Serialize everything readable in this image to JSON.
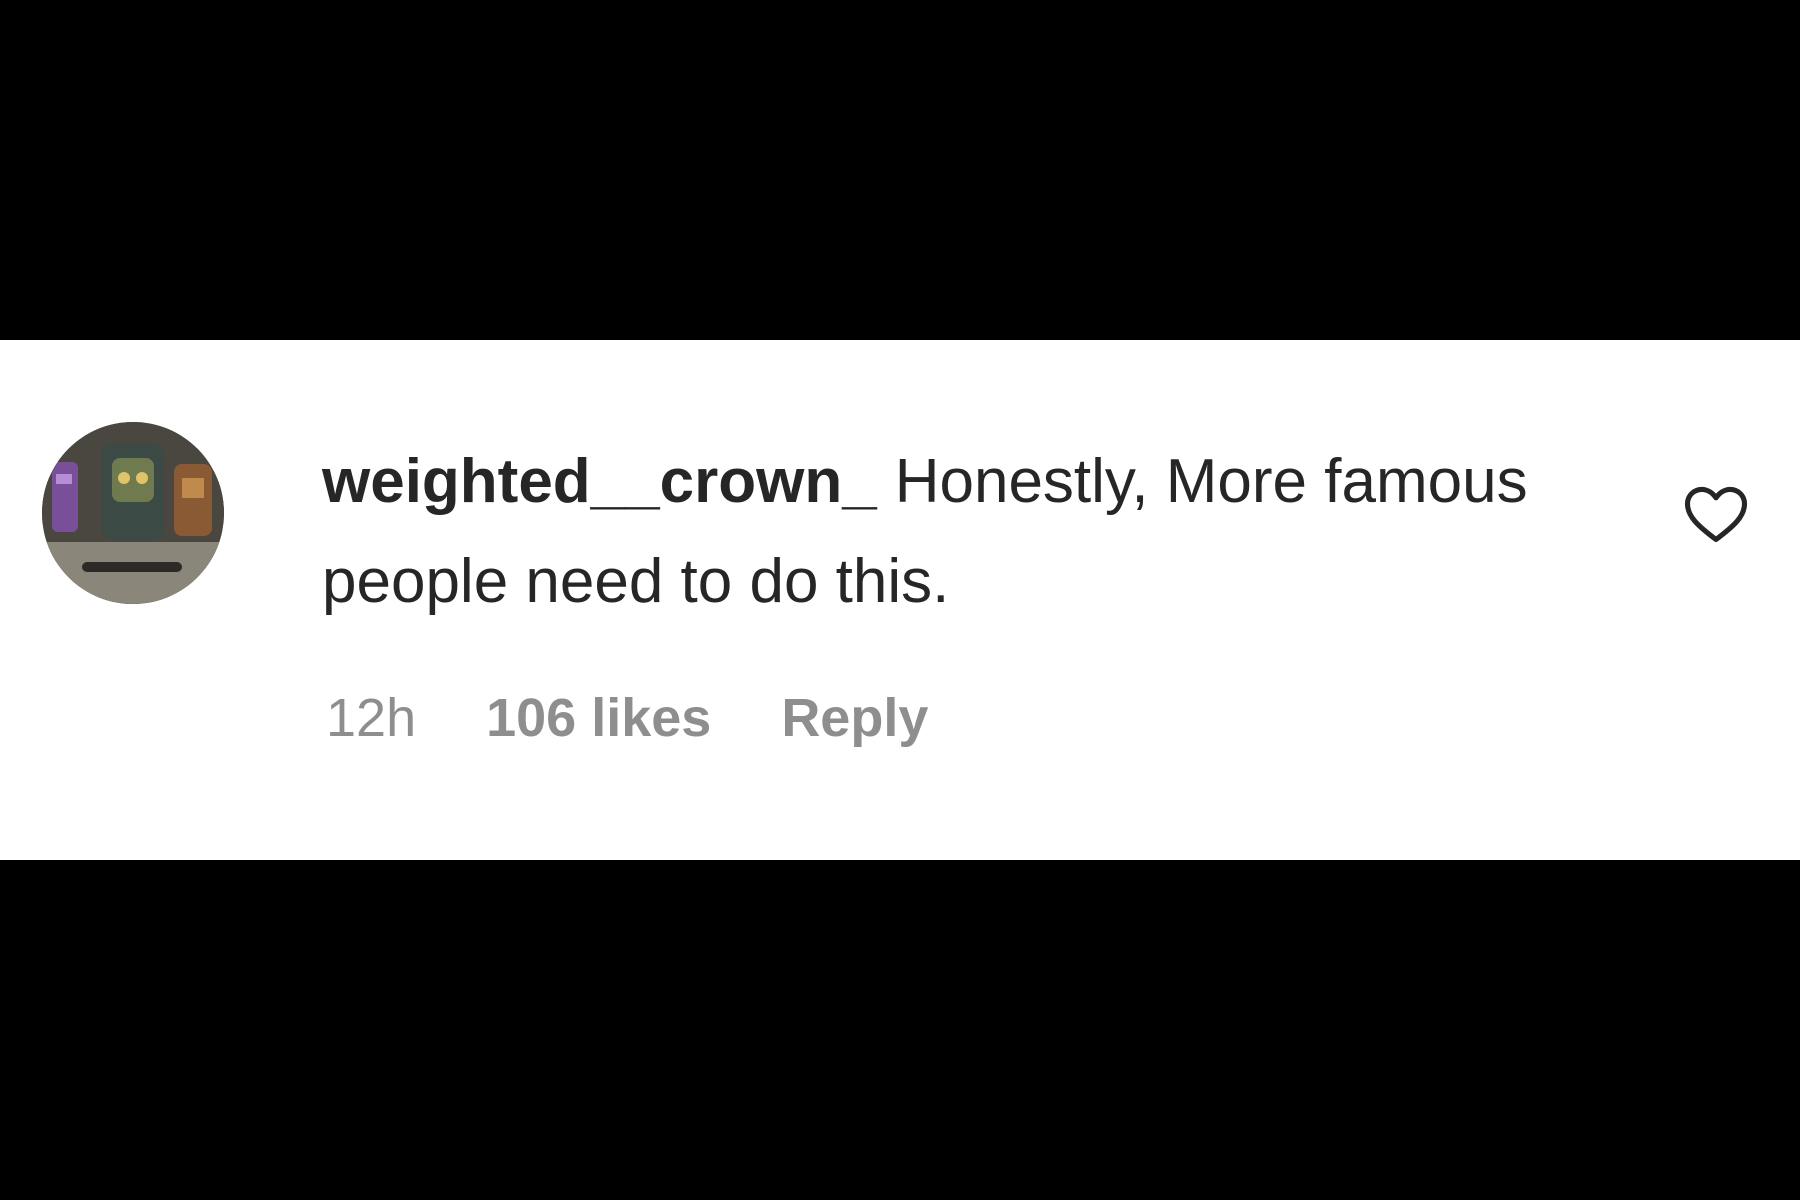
{
  "comment": {
    "username": "weighted__crown_",
    "text": "Honestly, More famous people need to do this.",
    "time": "12h",
    "likes": "106 likes",
    "reply_label": "Reply",
    "like_icon": "heart-outline-icon",
    "avatar_icon": "user-avatar-image"
  },
  "colors": {
    "background": "#000000",
    "panel": "#ffffff",
    "text_primary": "#262626",
    "text_secondary": "#8e8e8e"
  }
}
